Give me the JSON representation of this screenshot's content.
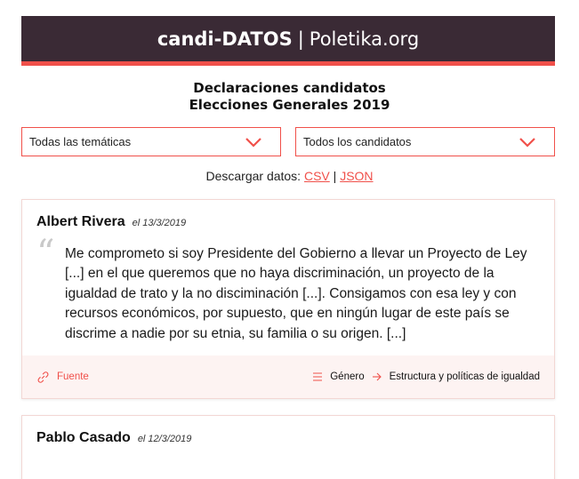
{
  "header": {
    "brand": "candi-DATOS",
    "separator": "|",
    "site": "Poletika.org"
  },
  "page_title": {
    "line1": "Declaraciones candidatos",
    "line2": "Elecciones Generales 2019"
  },
  "filters": {
    "tematicas": "Todas las temáticas",
    "candidatos": "Todos los candidatos"
  },
  "download": {
    "label": "Descargar datos:",
    "csv": "CSV",
    "separator": "|",
    "json": "JSON"
  },
  "statements": [
    {
      "name": "Albert Rivera",
      "date": "el 13/3/2019",
      "quote": "Me comprometo si soy Presidente del Gobierno a llevar un Proyecto de Ley [...] en el que queremos que no haya discriminación, un proyecto de la igualdad de trato y la no disciminación [...]. Consigamos con esa ley y con recursos económicos, por supuesto, que en ningún lugar de este país se discrime a nadie por su etnia, su familia o su origen. [...]",
      "source_label": "Fuente",
      "theme": "Género",
      "topic": "Estructura y políticas de igualdad"
    },
    {
      "name": "Pablo Casado",
      "date": "el 12/3/2019"
    }
  ],
  "colors": {
    "banner_bg": "#3a2a35",
    "accent": "#f0504a",
    "footer_bg": "#fdf3f2"
  },
  "icons": {
    "quote": "open-quote-icon",
    "source": "link-icon",
    "theme": "list-icon",
    "arrow": "arrow-right-icon",
    "select": "chevron-down-icon"
  }
}
